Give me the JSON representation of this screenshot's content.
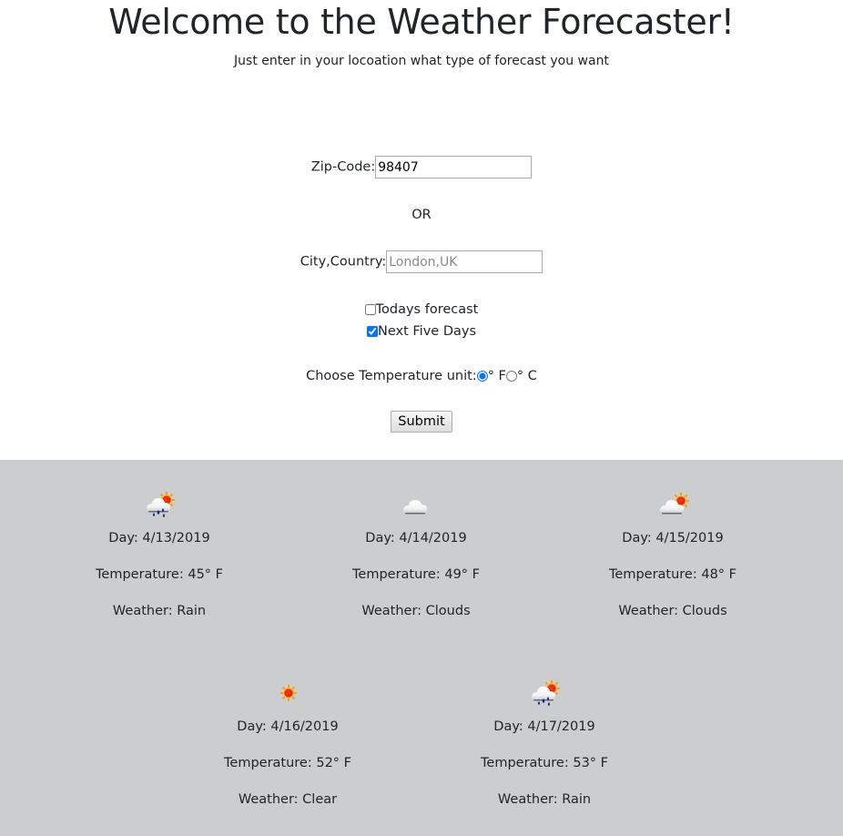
{
  "header": {
    "title": "Welcome to the Weather Forecaster!",
    "subtitle": "Just enter in your locoation what type of forecast you want"
  },
  "form": {
    "zip_label": "Zip-Code:",
    "zip_value": "98407",
    "or_label": "OR",
    "city_label": "City,Country:",
    "city_value": "",
    "city_placeholder": "London,UK",
    "options": [
      {
        "label": "Todays forecast",
        "checked": false
      },
      {
        "label": "Next Five Days",
        "checked": true
      }
    ],
    "unit_label": "Choose Temperature unit:",
    "units": [
      {
        "label": "° F",
        "selected": true
      },
      {
        "label": "° C",
        "selected": false
      }
    ],
    "submit_label": "Submit"
  },
  "forecast": [
    {
      "icon": "rain-sun-icon",
      "day": "Day: 4/13/2019",
      "temperature": "Temperature: 45° F",
      "weather": "Weather: Rain"
    },
    {
      "icon": "cloud-icon",
      "day": "Day: 4/14/2019",
      "temperature": "Temperature: 49° F",
      "weather": "Weather: Clouds"
    },
    {
      "icon": "cloud-sun-icon",
      "day": "Day: 4/15/2019",
      "temperature": "Temperature: 48° F",
      "weather": "Weather: Clouds"
    },
    {
      "icon": "sun-icon",
      "day": "Day: 4/16/2019",
      "temperature": "Temperature: 52° F",
      "weather": "Weather: Clear"
    },
    {
      "icon": "rain-sun-icon",
      "day": "Day: 4/17/2019",
      "temperature": "Temperature: 53° F",
      "weather": "Weather: Rain"
    }
  ],
  "colors": {
    "results_background": "#cccdcf",
    "text": "#212529"
  }
}
